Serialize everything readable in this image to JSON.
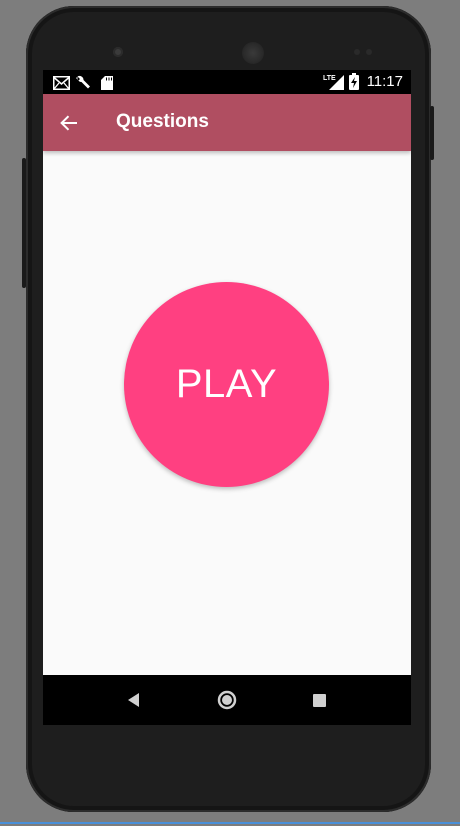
{
  "status_bar": {
    "time": "11:17",
    "network": "LTE",
    "icons": [
      "gmail-icon",
      "wrench-icon",
      "sd-card-icon",
      "lte-signal-icon",
      "battery-charging-icon"
    ]
  },
  "app_bar": {
    "title": "Questions",
    "back_icon": "arrow-back-icon",
    "color": "#b04e61"
  },
  "main": {
    "play_label": "PLAY",
    "play_color": "#ff4081",
    "background": "#fafafa"
  },
  "nav_bar": {
    "buttons": [
      "back-triangle-icon",
      "home-circle-icon",
      "recents-square-icon"
    ]
  }
}
